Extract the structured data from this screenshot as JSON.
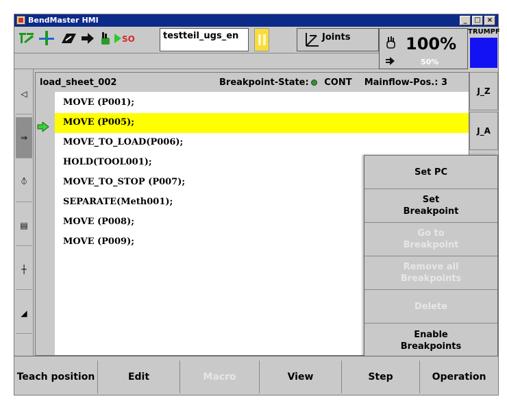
{
  "window": {
    "title": "BendMaster HMI",
    "minimize": "_",
    "maximize": "□",
    "close": "×"
  },
  "toolbar": {
    "program_name": "testteil_ugs_en",
    "mode_label": "Joints",
    "override": "100%",
    "override_sub": "50%",
    "brand": "TRUMPF",
    "brand_color": "#1212f2",
    "icons": [
      "tool-icon",
      "robot-axis-icon",
      "gripper-icon",
      "arrow-right-icon",
      "hand-icon",
      "io-icon"
    ]
  },
  "sidebar": {
    "items": [
      {
        "icon": "collapse-arrow-icon",
        "glyph": "◁"
      },
      {
        "icon": "program-icon",
        "glyph": "⇒"
      },
      {
        "icon": "coordinate-icon",
        "glyph": "⦽"
      },
      {
        "icon": "list-icon",
        "glyph": "▤"
      },
      {
        "icon": "axis-icon",
        "glyph": "┼"
      },
      {
        "icon": "tool-z-icon",
        "glyph": "◢"
      }
    ]
  },
  "program": {
    "file": "load_sheet_002",
    "breakpoint_label": "Breakpoint-State:",
    "state": "CONT",
    "mainflow_label": "Mainflow-Pos.:",
    "mainflow_value": "3",
    "lines": [
      "MOVE (P001);",
      "MOVE (P005);",
      "MOVE_TO_LOAD(P006);",
      "HOLD(TOOL001);",
      "MOVE_TO_STOP (P007);",
      "SEPARATE(Meth001);",
      "MOVE (P008);",
      "MOVE (P009);"
    ],
    "current_line": 1,
    "highlight_color": "#ffff00"
  },
  "right_buttons": [
    "J_Z",
    "J_A"
  ],
  "context_menu": [
    {
      "label": "Set PC",
      "enabled": true
    },
    {
      "label": "Set\nBreakpoint",
      "enabled": true
    },
    {
      "label": "Go to\nBreakpoint",
      "enabled": false
    },
    {
      "label": "Remove all\nBreakpoints",
      "enabled": false
    },
    {
      "label": "Delete",
      "enabled": false
    },
    {
      "label": "Enable\nBreakpoints",
      "enabled": true
    }
  ],
  "bottom_tabs": [
    {
      "label": "Teach position",
      "enabled": true
    },
    {
      "label": "Edit",
      "enabled": true
    },
    {
      "label": "Macro",
      "enabled": false
    },
    {
      "label": "View",
      "enabled": true
    },
    {
      "label": "Step",
      "enabled": true
    },
    {
      "label": "Operation",
      "enabled": true
    }
  ]
}
